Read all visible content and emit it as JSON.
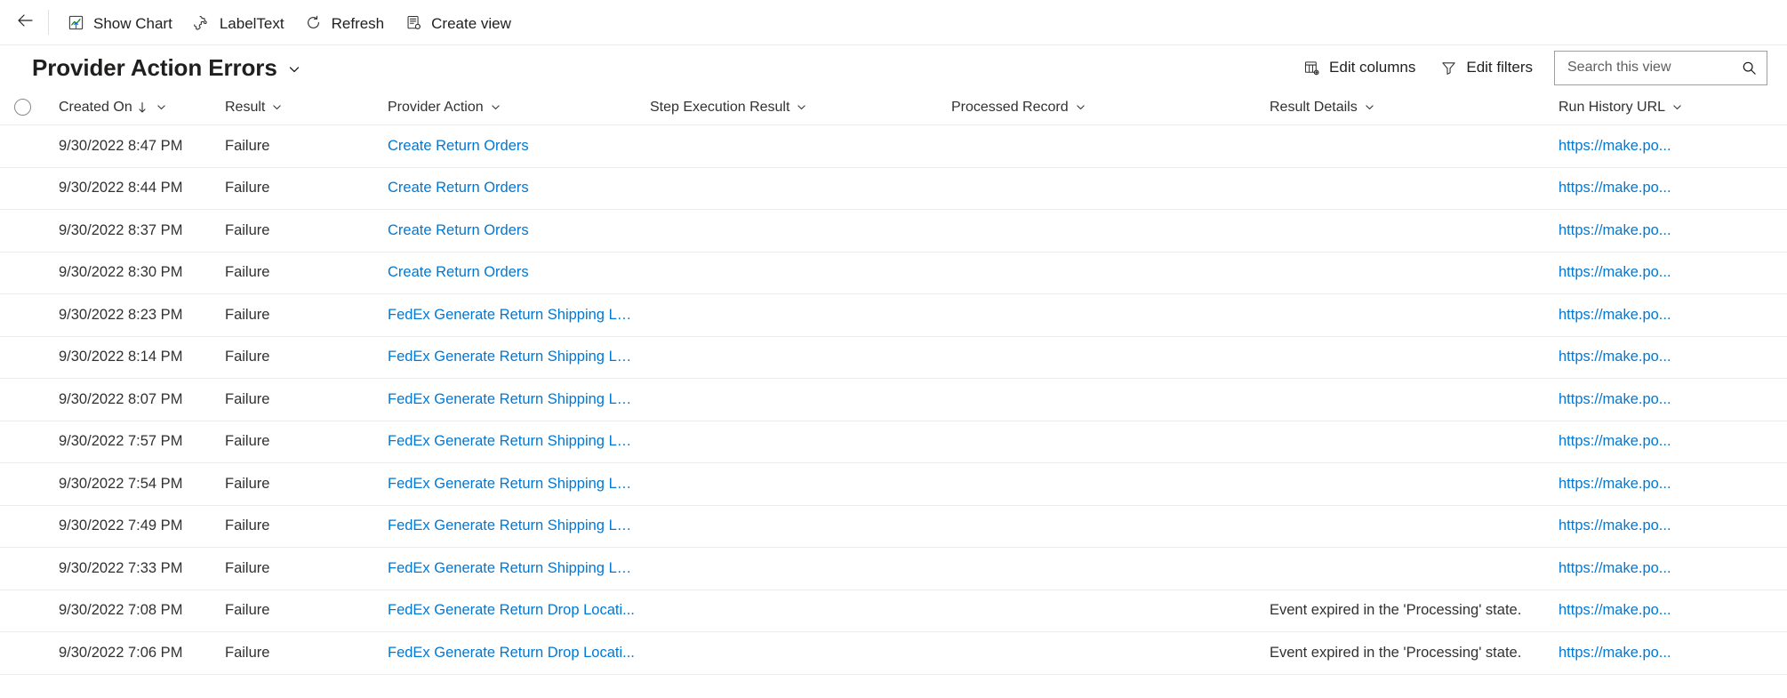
{
  "command_bar": {
    "back": {
      "label": "",
      "icon": "arrow-left-icon"
    },
    "buttons": [
      {
        "label": "Show Chart",
        "icon": "show-chart-icon"
      },
      {
        "label": "LabelText",
        "icon": "puzzle-icon"
      },
      {
        "label": "Refresh",
        "icon": "refresh-icon"
      },
      {
        "label": "Create view",
        "icon": "create-view-icon"
      }
    ]
  },
  "header": {
    "view_title": "Provider Action Errors",
    "edit_columns_label": "Edit columns",
    "edit_filters_label": "Edit filters",
    "search_placeholder": "Search this view",
    "search_value": ""
  },
  "grid": {
    "columns": [
      {
        "key": "created_on",
        "label": "Created On",
        "sorted": true,
        "sort_dir": "asc"
      },
      {
        "key": "result",
        "label": "Result",
        "sorted": false
      },
      {
        "key": "provider_action",
        "label": "Provider Action",
        "sorted": false
      },
      {
        "key": "step_execution_result",
        "label": "Step Execution Result",
        "sorted": false
      },
      {
        "key": "processed_record",
        "label": "Processed Record",
        "sorted": false
      },
      {
        "key": "result_details",
        "label": "Result Details",
        "sorted": false
      },
      {
        "key": "run_history_url",
        "label": "Run History URL",
        "sorted": false
      }
    ],
    "rows": [
      {
        "created_on": "9/30/2022 8:47 PM",
        "result": "Failure",
        "provider_action": "Create Return Orders",
        "step_execution_result": "",
        "processed_record": "",
        "result_details": "",
        "run_history_url": "https://make.po..."
      },
      {
        "created_on": "9/30/2022 8:44 PM",
        "result": "Failure",
        "provider_action": "Create Return Orders",
        "step_execution_result": "",
        "processed_record": "",
        "result_details": "",
        "run_history_url": "https://make.po..."
      },
      {
        "created_on": "9/30/2022 8:37 PM",
        "result": "Failure",
        "provider_action": "Create Return Orders",
        "step_execution_result": "",
        "processed_record": "",
        "result_details": "",
        "run_history_url": "https://make.po..."
      },
      {
        "created_on": "9/30/2022 8:30 PM",
        "result": "Failure",
        "provider_action": "Create Return Orders",
        "step_execution_result": "",
        "processed_record": "",
        "result_details": "",
        "run_history_url": "https://make.po..."
      },
      {
        "created_on": "9/30/2022 8:23 PM",
        "result": "Failure",
        "provider_action": "FedEx Generate Return Shipping La...",
        "step_execution_result": "",
        "processed_record": "",
        "result_details": "",
        "run_history_url": "https://make.po..."
      },
      {
        "created_on": "9/30/2022 8:14 PM",
        "result": "Failure",
        "provider_action": "FedEx Generate Return Shipping La...",
        "step_execution_result": "",
        "processed_record": "",
        "result_details": "",
        "run_history_url": "https://make.po..."
      },
      {
        "created_on": "9/30/2022 8:07 PM",
        "result": "Failure",
        "provider_action": "FedEx Generate Return Shipping La...",
        "step_execution_result": "",
        "processed_record": "",
        "result_details": "",
        "run_history_url": "https://make.po..."
      },
      {
        "created_on": "9/30/2022 7:57 PM",
        "result": "Failure",
        "provider_action": "FedEx Generate Return Shipping La...",
        "step_execution_result": "",
        "processed_record": "",
        "result_details": "",
        "run_history_url": "https://make.po..."
      },
      {
        "created_on": "9/30/2022 7:54 PM",
        "result": "Failure",
        "provider_action": "FedEx Generate Return Shipping La...",
        "step_execution_result": "",
        "processed_record": "",
        "result_details": "",
        "run_history_url": "https://make.po..."
      },
      {
        "created_on": "9/30/2022 7:49 PM",
        "result": "Failure",
        "provider_action": "FedEx Generate Return Shipping La...",
        "step_execution_result": "",
        "processed_record": "",
        "result_details": "",
        "run_history_url": "https://make.po..."
      },
      {
        "created_on": "9/30/2022 7:33 PM",
        "result": "Failure",
        "provider_action": "FedEx Generate Return Shipping La...",
        "step_execution_result": "",
        "processed_record": "",
        "result_details": "",
        "run_history_url": "https://make.po..."
      },
      {
        "created_on": "9/30/2022 7:08 PM",
        "result": "Failure",
        "provider_action": "FedEx Generate Return Drop Locati...",
        "step_execution_result": "",
        "processed_record": "",
        "result_details": "Event expired in the 'Processing' state.",
        "run_history_url": "https://make.po..."
      },
      {
        "created_on": "9/30/2022 7:06 PM",
        "result": "Failure",
        "provider_action": "FedEx Generate Return Drop Locati...",
        "step_execution_result": "",
        "processed_record": "",
        "result_details": "Event expired in the 'Processing' state.",
        "run_history_url": "https://make.po..."
      }
    ]
  },
  "colors": {
    "link": "#0078d4",
    "text": "#323130",
    "border": "#edebe9",
    "accent_chart": "#0f6cbd"
  }
}
